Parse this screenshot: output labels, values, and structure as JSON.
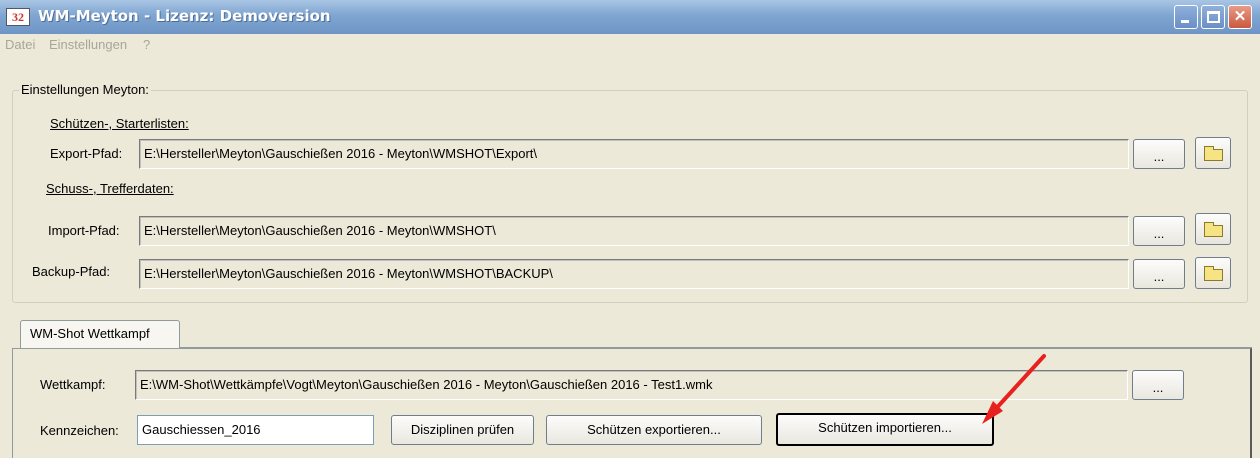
{
  "window": {
    "title": "WM-Meyton - Lizenz: Demoversion",
    "icon_text": "32"
  },
  "menu": {
    "items": [
      "Datei",
      "Einstellungen",
      "?"
    ]
  },
  "settings_group": {
    "title": "Einstellungen Meyton:",
    "shooters_section": "Schützen-, Starterlisten:",
    "export_label": "Export-Pfad:",
    "export_value": "E:\\Hersteller\\Meyton\\Gauschießen 2016 - Meyton\\WMSHOT\\Export\\",
    "shots_section": "Schuss-, Trefferdaten:",
    "import_label": "Import-Pfad:",
    "import_value": "E:\\Hersteller\\Meyton\\Gauschießen 2016 - Meyton\\WMSHOT\\",
    "backup_label": "Backup-Pfad:",
    "backup_value": "E:\\Hersteller\\Meyton\\Gauschießen 2016 - Meyton\\WMSHOT\\BACKUP\\",
    "browse_label": "..."
  },
  "tab": {
    "label": "WM-Shot Wettkampf"
  },
  "competition": {
    "wettkampf_label": "Wettkampf:",
    "wettkampf_value": "E:\\WM-Shot\\Wettkämpfe\\Vogt\\Meyton\\Gauschießen 2016 - Meyton\\Gauschießen 2016 - Test1.wmk",
    "browse_label": "...",
    "kennzeichen_label": "Kennzeichen:",
    "kennzeichen_value": "Gauschiessen_2016",
    "btn_disziplinen": "Disziplinen prüfen",
    "btn_export": "Schützen exportieren...",
    "btn_import": "Schützen importieren..."
  },
  "colors": {
    "titlebar": "#7fa5d1",
    "annotation_arrow": "#e8201e"
  }
}
